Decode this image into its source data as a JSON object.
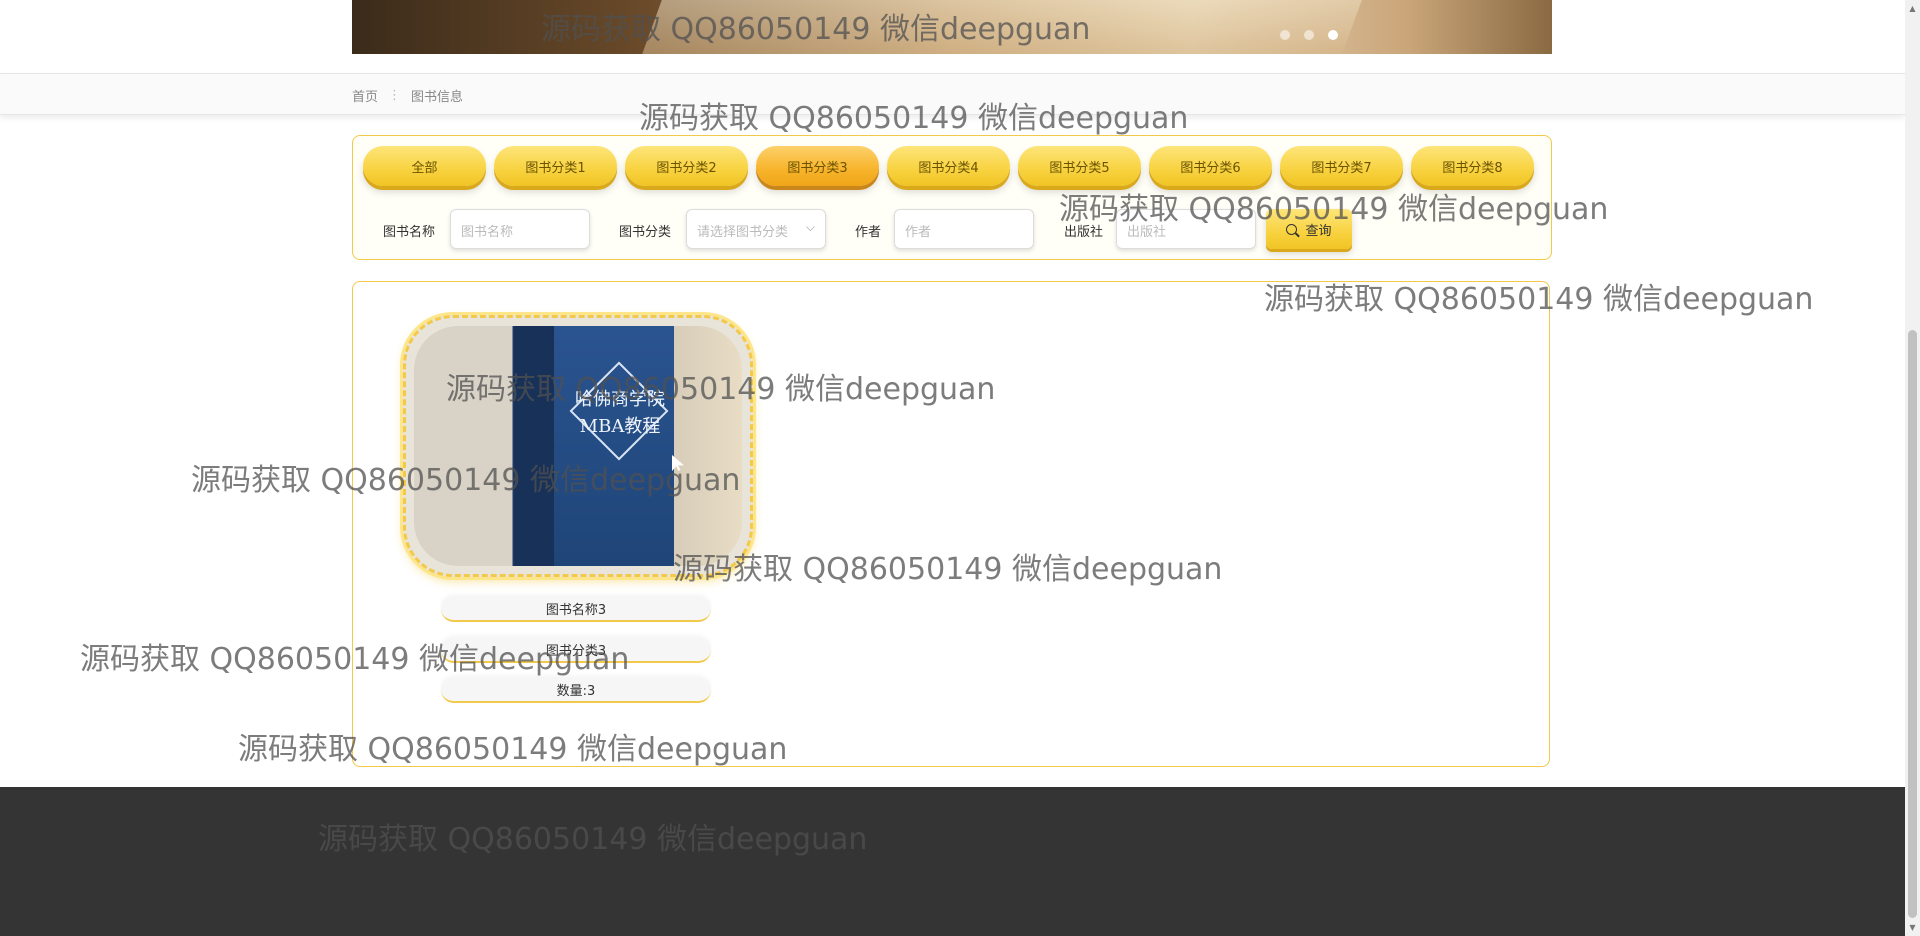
{
  "breadcrumb": {
    "home": "首页",
    "separator": "⋮",
    "current": "图书信息"
  },
  "tabs": [
    {
      "label": "全部",
      "active": false
    },
    {
      "label": "图书分类1",
      "active": false
    },
    {
      "label": "图书分类2",
      "active": false
    },
    {
      "label": "图书分类3",
      "active": true
    },
    {
      "label": "图书分类4",
      "active": false
    },
    {
      "label": "图书分类5",
      "active": false
    },
    {
      "label": "图书分类6",
      "active": false
    },
    {
      "label": "图书分类7",
      "active": false
    },
    {
      "label": "图书分类8",
      "active": false
    }
  ],
  "search": {
    "name_label": "图书名称",
    "name_placeholder": "图书名称",
    "category_label": "图书分类",
    "category_placeholder": "请选择图书分类",
    "author_label": "作者",
    "author_placeholder": "作者",
    "publisher_label": "出版社",
    "publisher_placeholder": "出版社",
    "query_button": "查询"
  },
  "books": [
    {
      "name": "图书名称3",
      "category": "图书分类3",
      "quantity": "数量:3",
      "cover_text": "哈佛商学院 MBA教程"
    }
  ],
  "watermark": "源码获取 QQ86050149 微信deepguan",
  "colors": {
    "accent": "#f8d23f",
    "active_tab": "#f7b32a",
    "border": "#f3c94b",
    "footer": "#343434"
  },
  "icons": {
    "search": "search-icon",
    "dropdown": "chevron-down-icon",
    "cursor": "pointer-cursor-icon"
  }
}
